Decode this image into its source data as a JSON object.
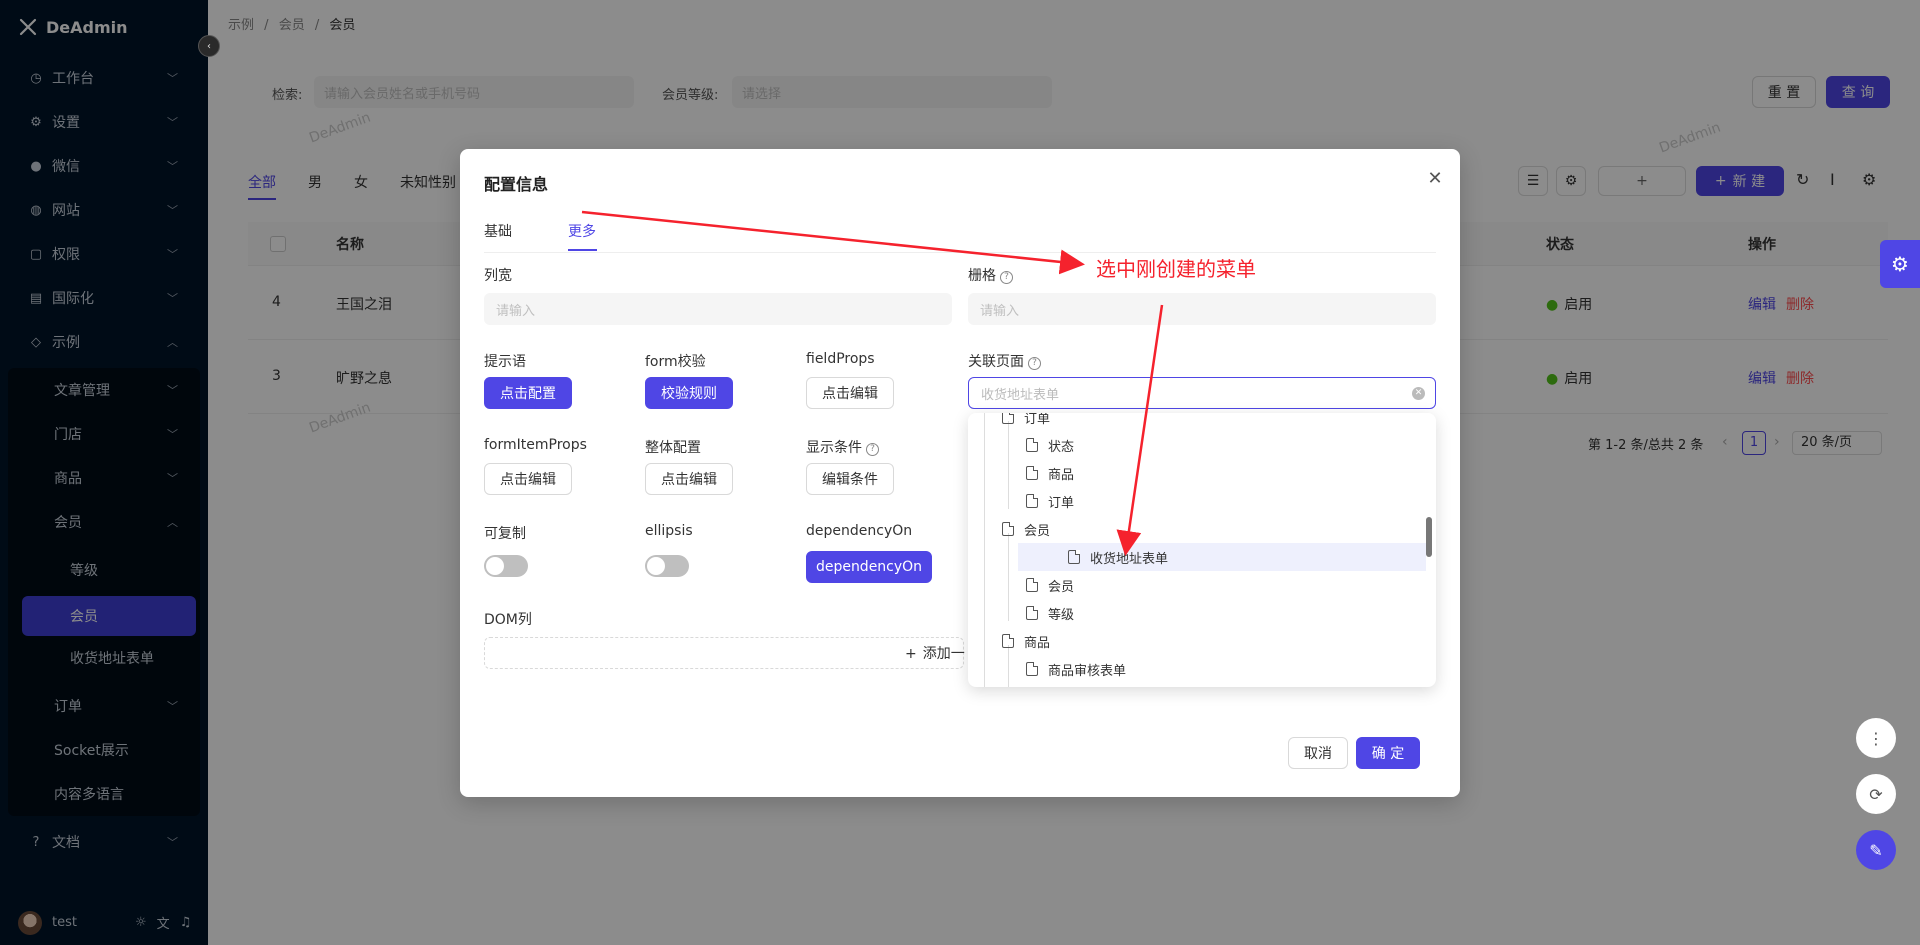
{
  "app": {
    "name": "DeAdmin"
  },
  "sidebar": {
    "items": [
      {
        "label": "工作台",
        "icon": "dashboard-icon"
      },
      {
        "label": "设置",
        "icon": "gear-icon"
      },
      {
        "label": "微信",
        "icon": "wechat-icon"
      },
      {
        "label": "网站",
        "icon": "globe-icon"
      },
      {
        "label": "权限",
        "icon": "lock-icon"
      },
      {
        "label": "国际化",
        "icon": "translate-icon"
      },
      {
        "label": "示例",
        "icon": "tag-icon"
      }
    ],
    "sub": {
      "article": "文章管理",
      "store": "门店",
      "goods": "商品",
      "member": "会员",
      "level": "等级",
      "member_active": "会员",
      "address_form": "收货地址表单",
      "order": "订单",
      "socket": "Socket展示",
      "i18n_content": "内容多语言"
    },
    "docs": "文档",
    "user": "test"
  },
  "breadcrumb": {
    "a": "示例",
    "b": "会员",
    "c": "会员",
    "sep": "/"
  },
  "search": {
    "label": "检索:",
    "placeholder": "请输入会员姓名或手机号码",
    "level_label": "会员等级:",
    "level_placeholder": "请选择",
    "reset": "重 置",
    "query": "查 询"
  },
  "list_tabs": [
    "全部",
    "男",
    "女",
    "未知性别"
  ],
  "table": {
    "headers": {
      "name": "名称",
      "status": "状态",
      "ops": "操作"
    },
    "rows": [
      {
        "id": "4",
        "name": "王国之泪",
        "status": "启用",
        "edit": "编辑",
        "del": "删除"
      },
      {
        "id": "3",
        "name": "旷野之息",
        "status": "启用",
        "edit": "编辑",
        "del": "删除"
      }
    ],
    "pagination": {
      "summary": "第 1-2 条/总共 2 条",
      "page": "1",
      "size": "20 条/页"
    },
    "new_btn": "新 建",
    "plus": "+"
  },
  "watermark": "DeAdmin",
  "modal": {
    "title": "配置信息",
    "tabs": [
      "基础",
      "更多"
    ],
    "col_width_label": "列宽",
    "col_width_placeholder": "请输入",
    "grid_label": "栅格",
    "grid_placeholder": "请输入",
    "tip_label": "提示语",
    "tip_btn": "点击配置",
    "form_validate_label": "form校验",
    "validate_btn": "校验规则",
    "field_props_label": "fieldProps",
    "field_props_btn": "点击编辑",
    "related_page_label": "关联页面",
    "related_page_placeholder": "收货地址表单",
    "form_item_props_label": "formItemProps",
    "form_item_props_btn": "点击编辑",
    "overall_label": "整体配置",
    "overall_btn": "点击编辑",
    "show_cond_label": "显示条件",
    "show_cond_btn": "编辑条件",
    "copyable_label": "可复制",
    "ellipsis_label": "ellipsis",
    "dependency_label": "dependencyOn",
    "dependency_btn": "dependencyOn",
    "dom_col_label": "DOM列",
    "add_btn": "添加一",
    "cancel": "取消",
    "ok": "确 定"
  },
  "tree": [
    {
      "label": "订单",
      "level": 1
    },
    {
      "label": "状态",
      "level": 2
    },
    {
      "label": "商品",
      "level": 2
    },
    {
      "label": "订单",
      "level": 2
    },
    {
      "label": "会员",
      "level": 1
    },
    {
      "label": "收货地址表单",
      "level": 2,
      "selected": true
    },
    {
      "label": "会员",
      "level": 2
    },
    {
      "label": "等级",
      "level": 2
    },
    {
      "label": "商品",
      "level": 1
    },
    {
      "label": "商品审核表单",
      "level": 2
    }
  ],
  "annotation": {
    "text": "选中刚创建的菜单"
  },
  "colors": {
    "primary": "#4f46e5",
    "sidebar": "#001529",
    "annotation": "#f5222d",
    "danger": "#ff4d4f",
    "success": "#52c41a"
  }
}
